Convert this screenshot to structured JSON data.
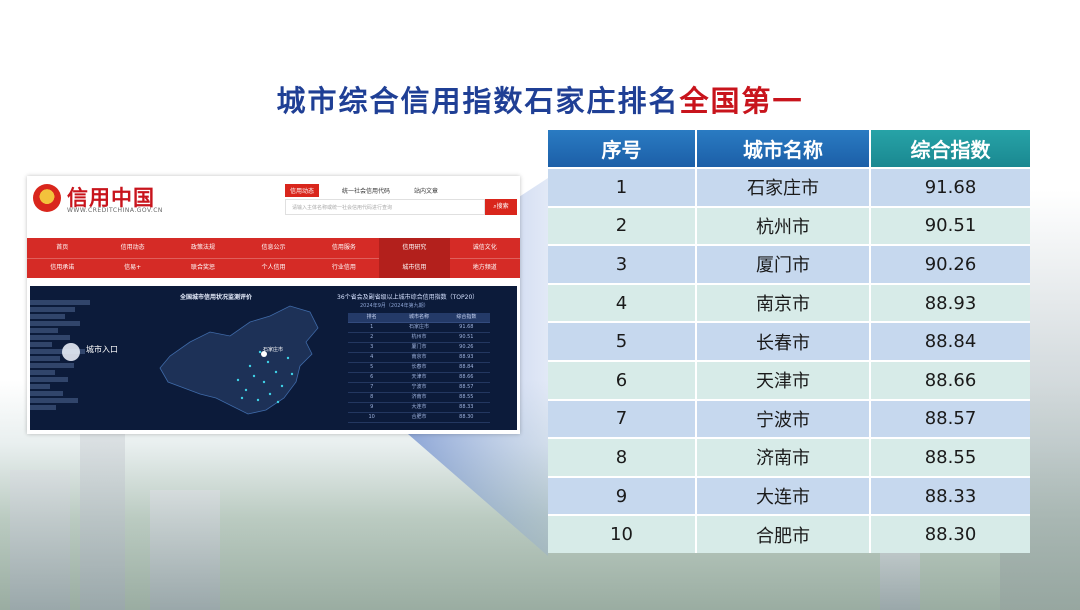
{
  "title": {
    "main": "城市综合信用指数石家庄排名",
    "highlight": "全国第一"
  },
  "site": {
    "logo_title": "信用中国",
    "logo_subtitle": "WWW.CREDITCHINA.GOV.CN",
    "header_tabs": [
      "信用动态",
      "统一社会信用代码",
      "站内文章"
    ],
    "search_placeholder": "请输入主体名称或统一社会信用代码进行查询",
    "search_button": "搜索",
    "nav_row1": [
      "首页",
      "信用动态",
      "政策法规",
      "信息公示",
      "信用服务",
      "信用研究",
      "诚信文化"
    ],
    "nav_row2": [
      "信用承诺",
      "信易+",
      "联合奖惩",
      "个人信用",
      "行业信用",
      "城市信用",
      "地方频道"
    ],
    "dashboard": {
      "title": "全国城市信用状况监测评价",
      "table_title": "36个省会及副省级以上城市综合信用指数（TOP20）",
      "table_subtitle": "2024年9月（2024年第九期）",
      "map_label": "石家庄市",
      "city_entry": "城市入口",
      "headers": [
        "排名",
        "城市名称",
        "综合指数"
      ],
      "rows": [
        [
          "1",
          "石家庄市",
          "91.68"
        ],
        [
          "2",
          "杭州市",
          "90.51"
        ],
        [
          "3",
          "厦门市",
          "90.26"
        ],
        [
          "4",
          "南京市",
          "88.93"
        ],
        [
          "5",
          "长春市",
          "88.84"
        ],
        [
          "6",
          "天津市",
          "88.66"
        ],
        [
          "7",
          "宁波市",
          "88.57"
        ],
        [
          "8",
          "济南市",
          "88.55"
        ],
        [
          "9",
          "大连市",
          "88.33"
        ],
        [
          "10",
          "合肥市",
          "88.30"
        ]
      ]
    }
  },
  "ranking": {
    "headers": [
      "序号",
      "城市名称",
      "综合指数"
    ],
    "rows": [
      {
        "no": "1",
        "city": "石家庄市",
        "index": "91.68"
      },
      {
        "no": "2",
        "city": "杭州市",
        "index": "90.51"
      },
      {
        "no": "3",
        "city": "厦门市",
        "index": "90.26"
      },
      {
        "no": "4",
        "city": "南京市",
        "index": "88.93"
      },
      {
        "no": "5",
        "city": "长春市",
        "index": "88.84"
      },
      {
        "no": "6",
        "city": "天津市",
        "index": "88.66"
      },
      {
        "no": "7",
        "city": "宁波市",
        "index": "88.57"
      },
      {
        "no": "8",
        "city": "济南市",
        "index": "88.55"
      },
      {
        "no": "9",
        "city": "大连市",
        "index": "88.33"
      },
      {
        "no": "10",
        "city": "合肥市",
        "index": "88.30"
      }
    ]
  },
  "colors": {
    "title_blue": "#1f3f95",
    "title_red": "#c8141c",
    "header_blue": "#1c5fa8",
    "header_teal": "#1a8891",
    "row_blue": "#c6d8ee",
    "row_green": "#d7ebe8",
    "site_red": "#d52b26"
  }
}
